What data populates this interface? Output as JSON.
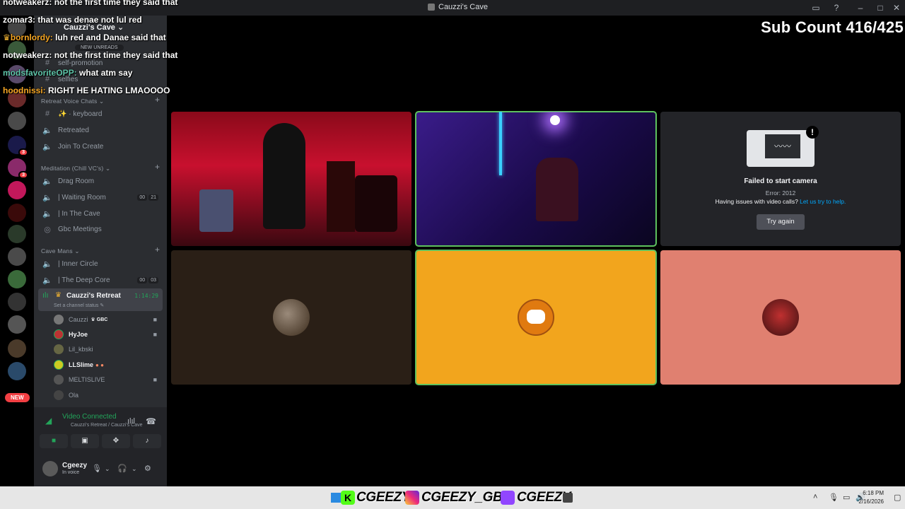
{
  "window": {
    "title": "Cauzzi's Cave"
  },
  "overlay": {
    "sub_count": "Sub Count 416/425",
    "chat": [
      {
        "user": "notweakerz:",
        "message": "not the first time they said that"
      },
      {
        "user": "zomar3:",
        "message": "that was denae not lul red"
      },
      {
        "user": "bornlordy:",
        "message": "luh red and Danae said that"
      },
      {
        "user": "notweakerz:",
        "message": "not the first time they said that"
      },
      {
        "user": "modsfavoriteOPP:",
        "message": "what atm say"
      },
      {
        "user": "hoodnissi:",
        "message": "RIGHT HE HATING LMAOOOO"
      }
    ]
  },
  "server_rail": {
    "badges": [
      "3",
      "3",
      "2"
    ],
    "new_label": "NEW"
  },
  "sidebar": {
    "server_name": "Cauzzi's Cave",
    "new_unreads": "NEW UNREADS",
    "top_channels": [
      {
        "name": "self-promotion"
      },
      {
        "name": "selfies"
      }
    ],
    "categories": {
      "retreat": "Retreat Voice Chats",
      "meditation": "Meditation (Chill VC's)",
      "cave_mans": "Cave Mans"
    },
    "channels": [
      {
        "name": "keyboard",
        "icon": "hash-icon"
      },
      {
        "name": "Retreated",
        "icon": "speaker-icon"
      },
      {
        "name": "Join To Create",
        "icon": "speaker-icon"
      },
      {
        "name": "Drag Room",
        "icon": "speaker-icon"
      },
      {
        "name": "| Waiting Room",
        "icon": "speaker-icon",
        "counts": [
          "00",
          "21"
        ]
      },
      {
        "name": "| In The Cave",
        "icon": "speaker-icon"
      },
      {
        "name": "Gbc Meetings",
        "icon": "stage-icon"
      },
      {
        "name": "| Inner Circle",
        "icon": "speaker-icon"
      },
      {
        "name": "| The Deep Core",
        "icon": "speaker-icon",
        "counts": [
          "00",
          "03"
        ]
      }
    ],
    "active_channel": {
      "name": "Cauzzi's Retreat",
      "time": "1:14:29",
      "status": "Set a channel status"
    },
    "voice_users": [
      {
        "name": "Cauzzi",
        "tag": "GBC"
      },
      {
        "name": "HyJoe"
      },
      {
        "name": "Lil_kbski"
      },
      {
        "name": "LLSlime"
      },
      {
        "name": "MELTISLIVE"
      },
      {
        "name": "Ola"
      }
    ]
  },
  "voice_panel": {
    "status": "Video Connected",
    "location": "Cauzzi's Retreat / Cauzzi's Cave",
    "user_name": "Cgeezy",
    "user_status": "In voice"
  },
  "video_grid": {
    "failed_tile": {
      "title": "Failed to start camera",
      "error": "Error: 2012",
      "help_text": "Having issues with video calls?",
      "help_link": "Let us try to help.",
      "button": "Try again"
    }
  },
  "bottom_bar": {
    "kick": "CGEEZY",
    "instagram": "CGEEZY_GBC",
    "twitch": "CGEEZY",
    "time": "6:18 PM",
    "date": "2/16/2026"
  }
}
